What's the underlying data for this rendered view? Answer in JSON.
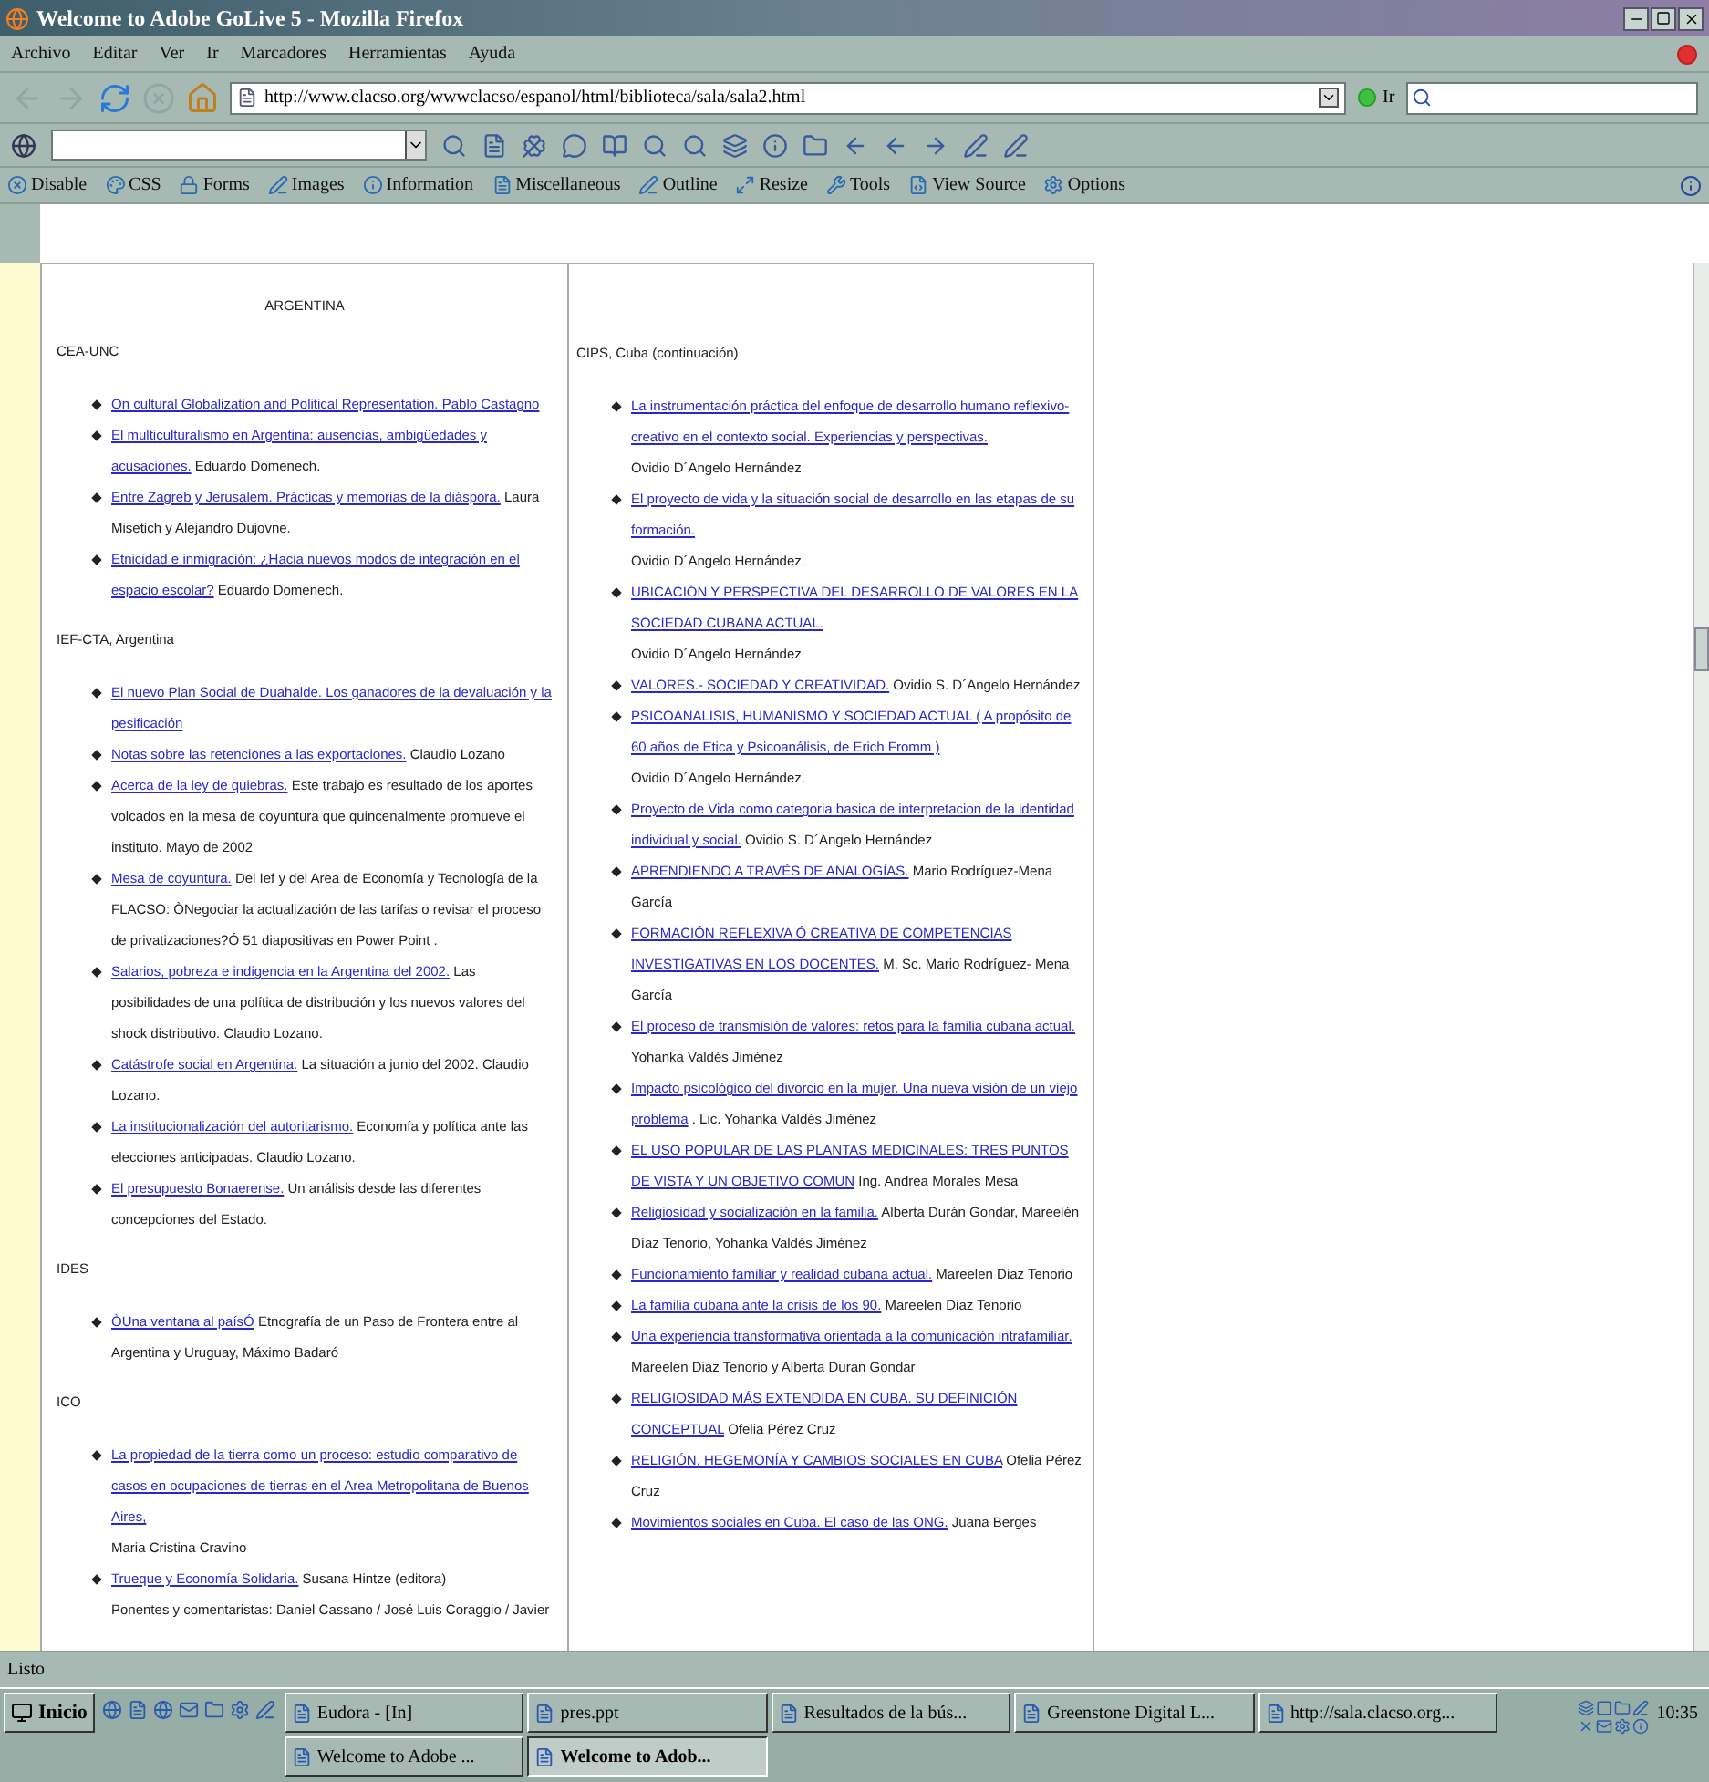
{
  "window": {
    "title": "Welcome to Adobe GoLive 5 - Mozilla Firefox"
  },
  "menu": [
    "Archivo",
    "Editar",
    "Ver",
    "Ir",
    "Marcadores",
    "Herramientas",
    "Ayuda"
  ],
  "navigation": {
    "url": "http://www.clacso.org/wwwclacso/espanol/html/biblioteca/sala/sala2.html",
    "go_button": "Ir"
  },
  "developer_toolbar": [
    "Disable",
    "CSS",
    "Forms",
    "Images",
    "Information",
    "Miscellaneous",
    "Outline",
    "Resize",
    "Tools",
    "View Source",
    "Options"
  ],
  "left_column": {
    "heading": "ARGENTINA",
    "sections": [
      {
        "name": "CEA-UNC",
        "items": [
          {
            "link": "On cultural Globalization and Political Representation. Pablo Castagno"
          },
          {
            "link": "El multiculturalismo en Argentina: ausencias, ambigüedades y acusaciones.",
            "text": "Eduardo Domenech."
          },
          {
            "link": "Entre Zagreb y Jerusalem. Prácticas y memorias de la diáspora.",
            "text": "Laura Misetich y Alejandro Dujovne."
          },
          {
            "link": "Etnicidad e inmigración: ¿Hacia nuevos modos de integración en el espacio escolar?",
            "text": "Eduardo Domenech."
          }
        ]
      },
      {
        "name": "IEF-CTA, Argentina",
        "items": [
          {
            "link": "El nuevo Plan Social de Duahalde. Los ganadores de la devaluación y la pesificación"
          },
          {
            "link": "Notas sobre las retenciones a las exportaciones.",
            "text": "Claudio Lozano"
          },
          {
            "link": "Acerca de la ley de quiebras.",
            "text": "Este trabajo es resultado de los aportes volcados en la mesa de coyuntura que quincenalmente promueve el instituto. Mayo de 2002"
          },
          {
            "link": "Mesa de coyuntura.",
            "text": "Del Ief y del Area de Economía y Tecnología de la FLACSO: ÒNegociar la actualización de las tarifas o revisar el proceso de privatizaciones?Ó 51 diapositivas en Power Point ."
          },
          {
            "link": "Salarios, pobreza e indigencia en la Argentina del 2002.",
            "text": "Las posibilidades de una política de distribución y los nuevos valores del shock distributivo. Claudio Lozano."
          },
          {
            "link": "Catástrofe social en Argentina.",
            "text": "La situación a junio del 2002. Claudio Lozano."
          },
          {
            "link": "La institucionalización del autoritarismo.",
            "text": "Economía y política ante las elecciones anticipadas. Claudio Lozano."
          },
          {
            "link": "El presupuesto Bonaerense.",
            "text": "Un análisis desde las diferentes concepciones del Estado."
          }
        ]
      },
      {
        "name": "IDES",
        "items": [
          {
            "link": "ÒUna ventana al paísÓ",
            "text": "Etnografía de un Paso de Frontera entre al Argentina y Uruguay, Máximo Badaró"
          }
        ]
      },
      {
        "name": "ICO",
        "items": [
          {
            "link": "La propiedad de la tierra como un proceso: estudio comparativo de casos en ocupaciones de tierras en el Area Metropolitana de Buenos Aires,",
            "text": "Maria Cristina Cravino",
            "text_below": true
          },
          {
            "link": "Trueque y Economía Solidaria.",
            "text": "Susana Hintze (editora)",
            "note": "Ponentes y comentaristas: Daniel Cassano / José Luis Coraggio / Javier"
          }
        ]
      }
    ]
  },
  "right_column": {
    "sections": [
      {
        "name": "CIPS, Cuba (continuación)",
        "items": [
          {
            "link": "La instrumentación práctica del enfoque de desarrollo humano reflexivo-creativo en el contexto social. Experiencias y perspectivas.",
            "text": "Ovidio D´Angelo Hernández",
            "text_below": true
          },
          {
            "link": "El proyecto de vida y la situación social de desarrollo en las etapas de su formación.",
            "text": "Ovidio D´Angelo Hernández.",
            "text_below": true
          },
          {
            "link": "UBICACIÓN Y PERSPECTIVA DEL DESARROLLO DE VALORES EN LA SOCIEDAD CUBANA ACTUAL.",
            "text": "Ovidio D´Angelo Hernández",
            "text_below": true
          },
          {
            "link": "VALORES.- SOCIEDAD Y CREATIVIDAD.",
            "text": "Ovidio S. D´Angelo Hernández"
          },
          {
            "link": "PSICOANALISIS, HUMANISMO Y SOCIEDAD ACTUAL ( A propósito de 60 años de Etica y Psicoanálisis, de Erich Fromm )",
            "text": "Ovidio D´Angelo Hernández.",
            "text_below": true
          },
          {
            "link": "Proyecto de Vida como categoria basica de interpretacion de la identidad individual y social.",
            "text": "Ovidio S. D´Angelo Hernández"
          },
          {
            "link": "APRENDIENDO A TRAVÉS DE ANALOGÍAS.",
            "text": "Mario Rodríguez-Mena García"
          },
          {
            "link": "FORMACIÓN REFLEXIVA Ó CREATIVA DE COMPETENCIAS INVESTIGATIVAS EN LOS DOCENTES.",
            "text": "M. Sc. Mario Rodríguez- Mena García"
          },
          {
            "link": "El proceso de transmisión de valores: retos para la familia cubana actual.",
            "text": "Yohanka Valdés Jiménez",
            "text_below": true
          },
          {
            "link": "Impacto psicológico del divorcio en la mujer. Una nueva visión de un viejo problema",
            "text": ". Lic. Yohanka Valdés Jiménez"
          },
          {
            "link": "EL USO POPULAR DE LAS PLANTAS MEDICINALES: TRES PUNTOS DE VISTA Y UN OBJETIVO COMUN",
            "text": "Ing. Andrea Morales Mesa"
          },
          {
            "link": "Religiosidad y socialización en la familia.",
            "text": "Alberta Durán Gondar, Mareelén Díaz Tenorio, Yohanka Valdés Jiménez"
          },
          {
            "link": "Funcionamiento familiar y realidad cubana actual.",
            "text": "Mareelen Diaz Tenorio"
          },
          {
            "link": "La familia cubana ante la crisis de los 90.",
            "text": "Mareelen Diaz Tenorio"
          },
          {
            "link": "Una experiencia transformativa orientada a la comunicación intrafamiliar.",
            "text": "Mareelen Diaz Tenorio y Alberta Duran Gondar"
          },
          {
            "link": "RELIGIOSIDAD MÁS EXTENDIDA EN CUBA. SU DEFINICIÓN CONCEPTUAL",
            "text": "Ofelia Pérez Cruz"
          },
          {
            "link": "RELIGIÓN, HEGEMONÍA Y CAMBIOS SOCIALES EN CUBA",
            "text": "Ofelia Pérez Cruz"
          },
          {
            "link": "Movimientos sociales en Cuba. El caso de las ONG.",
            "text": "Juana Berges"
          }
        ]
      }
    ]
  },
  "status_bar": "Listo",
  "taskbar": {
    "start": "Inicio",
    "tasks": [
      {
        "label": "Eudora - [In]",
        "selected": false
      },
      {
        "label": "pres.ppt",
        "selected": false
      },
      {
        "label": "Resultados de la bús...",
        "selected": false
      },
      {
        "label": "Greenstone Digital L...",
        "selected": false
      },
      {
        "label": "http://sala.clacso.org...",
        "selected": false
      },
      {
        "label": "Welcome to Adobe ...",
        "selected": false
      },
      {
        "label": "Welcome to Adob...",
        "selected": true
      }
    ],
    "clock": "10:35"
  }
}
